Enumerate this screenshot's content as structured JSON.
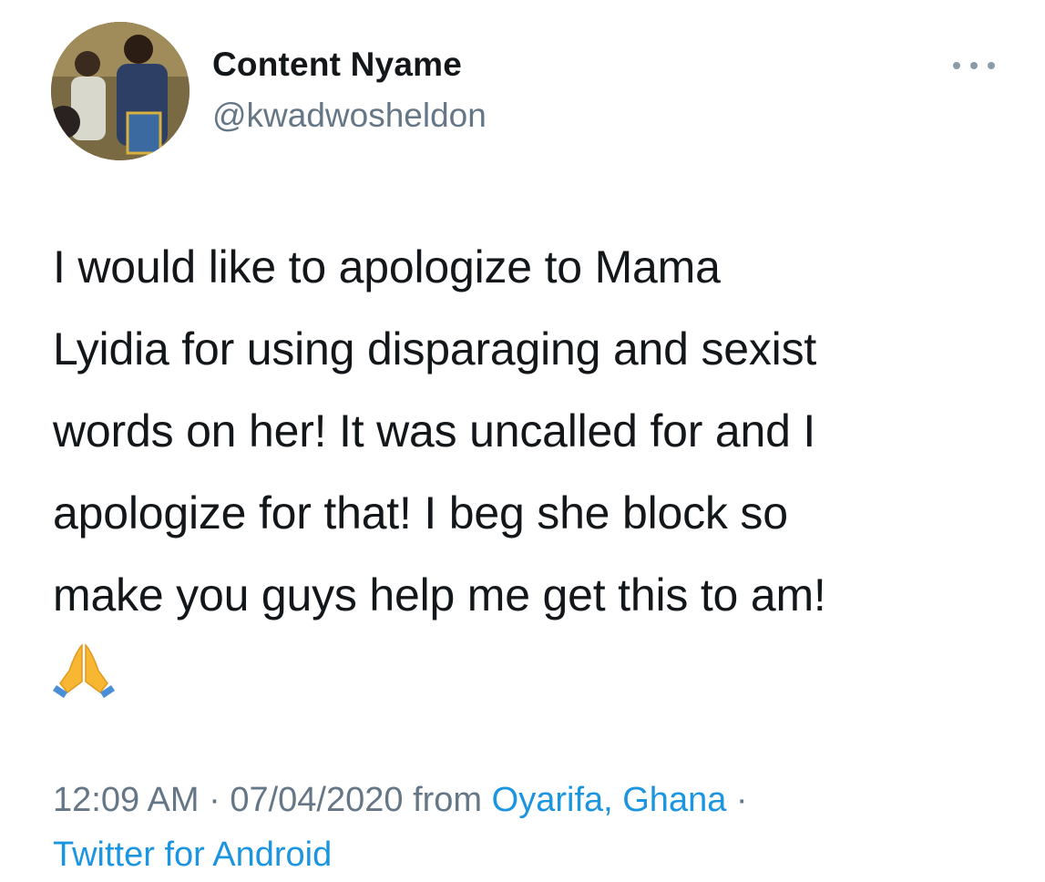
{
  "tweet": {
    "author": {
      "display_name": "Content Nyame",
      "handle": "@kwadwosheldon"
    },
    "more_icon": "more-horizontal-icon",
    "text": "I would like to apologize to Mama\nLyidia for using disparaging and sexist\nwords on her! It was uncalled for and I\napologize for that! I beg she block so\nmake you guys help me get this to am!",
    "emoji": "folded-hands-emoji",
    "meta": {
      "time": "12:09 AM",
      "separator": " · ",
      "date": "07/04/2020",
      "from_label": " from ",
      "location": "Oyarifa, Ghana",
      "separator2": " · ",
      "source": "Twitter for Android"
    },
    "colors": {
      "text": "#14171a",
      "secondary": "#657786",
      "link": "#1b95e0"
    }
  }
}
